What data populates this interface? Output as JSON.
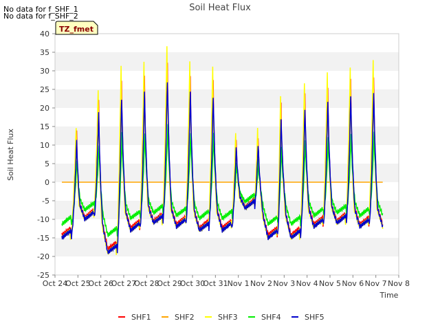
{
  "notes": [
    "No data for f_SHF_1",
    "No data for f_SHF_2"
  ],
  "badge": "TZ_fmet",
  "chart_data": {
    "type": "line",
    "title": "Soil Heat Flux",
    "xlabel": "Time",
    "ylabel": "Soil Heat Flux",
    "ylim": [
      -25,
      40
    ],
    "yticks": [
      -25,
      -20,
      -15,
      -10,
      -5,
      0,
      5,
      10,
      15,
      20,
      25,
      30,
      35,
      40
    ],
    "xlim": [
      0,
      15
    ],
    "xticks": [
      "Oct 24",
      "Oct 25",
      "Oct 26",
      "Oct 27",
      "Oct 28",
      "Oct 29",
      "Oct 30",
      "Oct 31",
      "Nov 1",
      "Nov 2",
      "Nov 3",
      "Nov 4",
      "Nov 5",
      "Nov 6",
      "Nov 7",
      "Nov 8"
    ],
    "x_start_day": 0.3,
    "x_end_day": 14.3,
    "grid": "horizontal bands",
    "legend_position": "bottom",
    "days": [
      {
        "night": -15,
        "peak": 14,
        "peakHour": 15
      },
      {
        "night": -10,
        "peak": 23,
        "peakHour": 14
      },
      {
        "night": -19,
        "peak": 29,
        "peakHour": 14
      },
      {
        "night": -13,
        "peak": 30,
        "peakHour": 14
      },
      {
        "night": -11,
        "peak": 34,
        "peakHour": 14
      },
      {
        "night": -12,
        "peak": 30,
        "peakHour": 14
      },
      {
        "night": -13,
        "peak": 29,
        "peakHour": 14
      },
      {
        "night": -13,
        "peak": 12,
        "peakHour": 14
      },
      {
        "night": -7,
        "peak": 13,
        "peakHour": 13
      },
      {
        "night": -15,
        "peak": 22,
        "peakHour": 13
      },
      {
        "night": -15,
        "peak": 25,
        "peakHour": 14
      },
      {
        "night": -12,
        "peak": 27,
        "peakHour": 14
      },
      {
        "night": -11,
        "peak": 29,
        "peakHour": 14
      },
      {
        "night": -12,
        "peak": 30,
        "peakHour": 14
      }
    ],
    "series": [
      {
        "name": "SHF1",
        "color": "#ff0000",
        "scale": 0.95,
        "nightScale": 0.95,
        "phase": 0.5,
        "constant": null
      },
      {
        "name": "SHF2",
        "color": "#ffa500",
        "scale": 0,
        "nightScale": 0,
        "phase": 0,
        "constant": 0
      },
      {
        "name": "SHF3",
        "color": "#ffff00",
        "scale": 1.08,
        "nightScale": 1.0,
        "phase": 0,
        "constant": null
      },
      {
        "name": "SHF4",
        "color": "#00ee00",
        "scale": 0.45,
        "nightScale": 0.75,
        "phase": 1.0,
        "constant": null
      },
      {
        "name": "SHF5",
        "color": "#0000cc",
        "scale": 0.88,
        "nightScale": 1.0,
        "phase": 0.7,
        "constant": null
      }
    ]
  }
}
